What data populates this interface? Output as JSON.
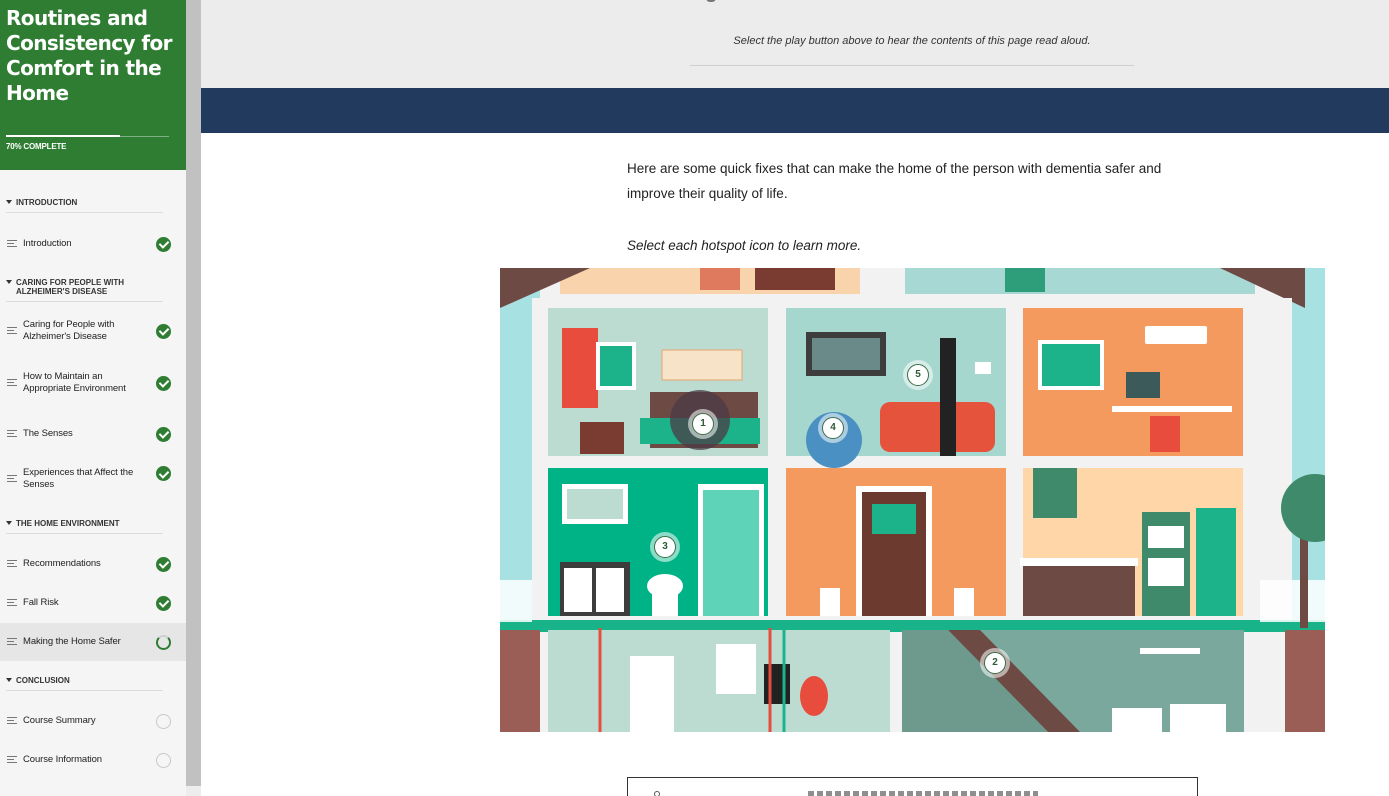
{
  "sidebar": {
    "course_title": "Routines and Consistency for Comfort in the Home",
    "progress_label": "70% COMPLETE",
    "progress_fraction": 0.7,
    "sections": [
      {
        "title": "INTRODUCTION"
      },
      {
        "title": "CARING FOR PEOPLE WITH ALZHEIMER'S DISEASE"
      },
      {
        "title": "THE HOME ENVIRONMENT"
      },
      {
        "title": "CONCLUSION"
      }
    ],
    "lessons": [
      {
        "label": "Introduction",
        "status": "complete"
      },
      {
        "label": "Caring for People with Alzheimer's Disease",
        "status": "complete"
      },
      {
        "label": "How to Maintain an Appropriate Environment",
        "status": "complete"
      },
      {
        "label": "The Senses",
        "status": "complete"
      },
      {
        "label": "Experiences that Affect the Senses",
        "status": "complete"
      },
      {
        "label": "Recommendations",
        "status": "complete"
      },
      {
        "label": "Fall Risk",
        "status": "complete"
      },
      {
        "label": "Making the Home Safer",
        "status": "in-progress"
      },
      {
        "label": "Course Summary",
        "status": "not-started"
      },
      {
        "label": "Course Information",
        "status": "not-started"
      }
    ],
    "icons": {
      "lesson": "lines-icon",
      "complete": "check-circle-icon"
    }
  },
  "main": {
    "audio_note": "Select the play button above to hear the contents of this page read aloud.",
    "intro_text": "Here are some quick fixes that can make the home of the person with dementia safer and improve their quality of life.",
    "instruction": "Select each hotspot icon to learn more.",
    "hotspots": [
      {
        "label": "1"
      },
      {
        "label": "2"
      },
      {
        "label": "3"
      },
      {
        "label": "4"
      },
      {
        "label": "5"
      }
    ]
  },
  "colors": {
    "brand_green": "#2e7d32",
    "navy": "#223a5e",
    "roof": "#6d4a44",
    "sky": "#a8e1e2",
    "wall": "#f2f2f2"
  }
}
